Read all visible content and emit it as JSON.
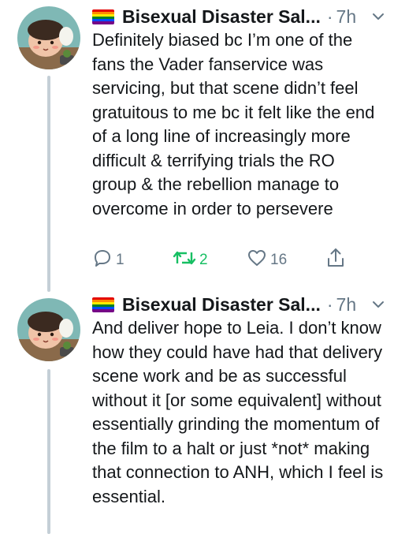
{
  "tweets": [
    {
      "display_name": "Bisexual Disaster Sal...",
      "separator": "·",
      "time": "7h",
      "text": "Definitely biased bc I’m one of the fans the Vader fanservice was servicing, but that scene didn’t feel gratuitous to me bc it felt like the end of a long line of increasingly more difficult & terrifying trials the RO group & the rebellion manage to overcome in order to persevere",
      "replies": "1",
      "retweets": "2",
      "likes": "16"
    },
    {
      "display_name": "Bisexual Disaster Sal...",
      "separator": "·",
      "time": "7h",
      "text": "And deliver hope to Leia. I don’t know how they could have had that delivery scene work and be as successful without it [or some equivalent] without essentially grinding the momentum of the film to a halt or just *not* making that connection to ANH, which I feel is essential."
    }
  ],
  "icons": {
    "flag": "rainbow-flag-icon",
    "menu": "chevron-down-icon",
    "reply": "reply-icon",
    "retweet": "retweet-icon",
    "like": "heart-icon",
    "share": "share-icon"
  },
  "colors": {
    "text": "#14171a",
    "secondary": "#657786",
    "retweet_active": "#17bf63",
    "thread_line": "#c4cfd6"
  }
}
